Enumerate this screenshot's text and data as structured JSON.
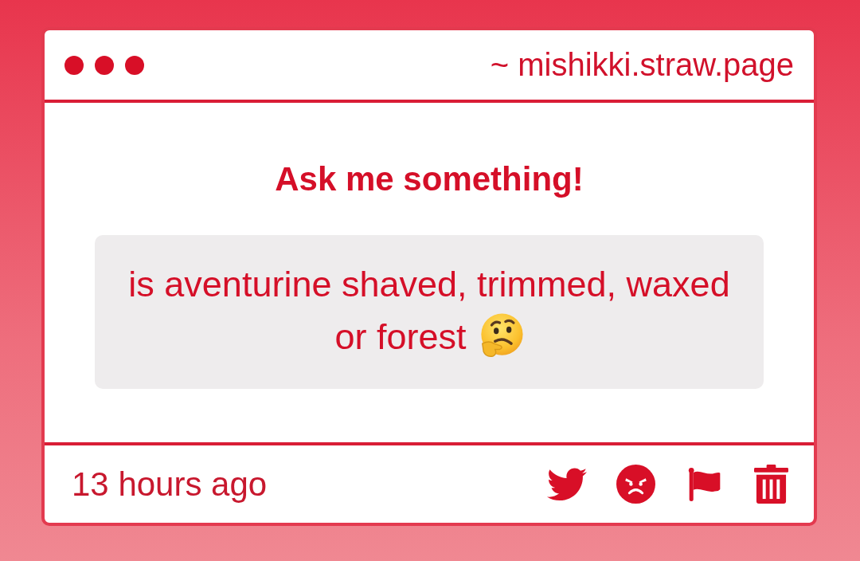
{
  "window": {
    "address": "~ mishikki.straw.page"
  },
  "prompt": {
    "title": "Ask me something!"
  },
  "question": {
    "text": "is aventurine shaved, trimmed, waxed or forest"
  },
  "footer": {
    "time": "13 hours ago"
  }
}
